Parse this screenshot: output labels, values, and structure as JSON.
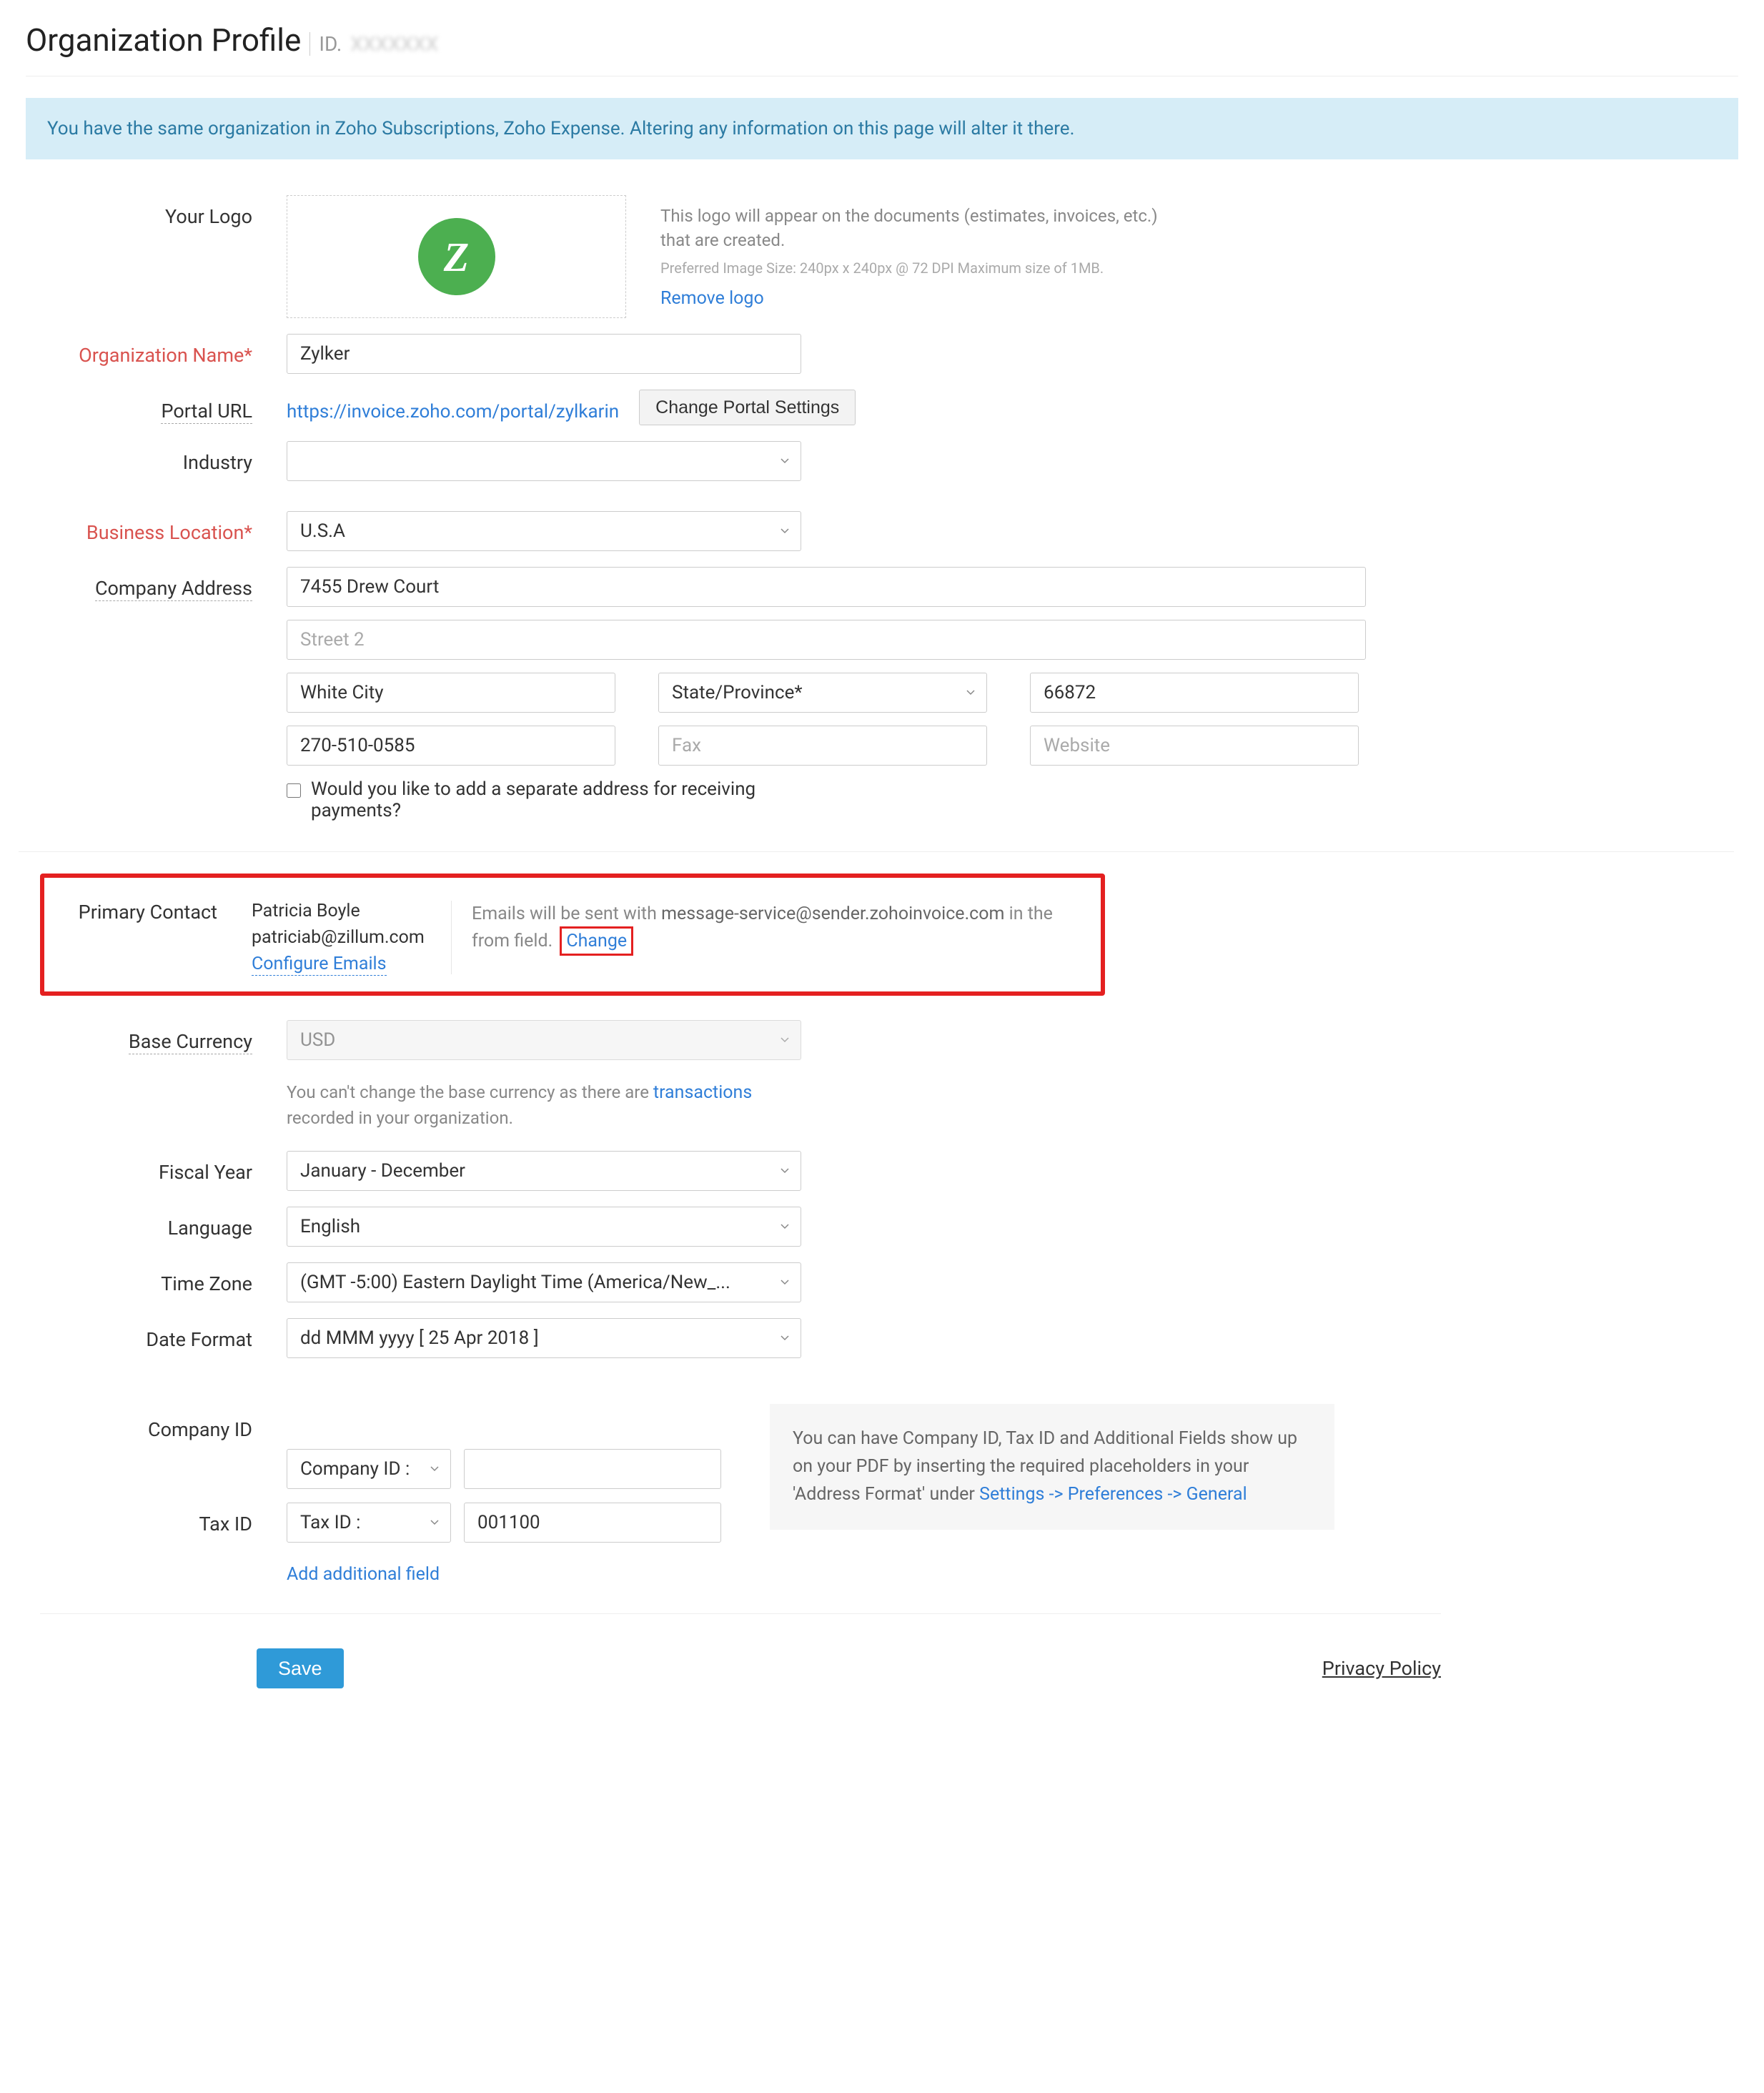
{
  "header": {
    "title": "Organization Profile",
    "id_label": "ID.",
    "id_value": "XXXXXXX"
  },
  "notice": "You have the same organization in Zoho Subscriptions, Zoho Expense. Altering any information on this page will alter it there.",
  "labels": {
    "logo": "Your Logo",
    "org_name": "Organization Name*",
    "portal_url": "Portal URL",
    "industry": "Industry",
    "business_location": "Business Location*",
    "company_address": "Company Address",
    "primary_contact": "Primary Contact",
    "base_currency": "Base Currency",
    "fiscal_year": "Fiscal Year",
    "language": "Language",
    "time_zone": "Time Zone",
    "date_format": "Date Format",
    "company_id": "Company ID",
    "tax_id": "Tax ID"
  },
  "logo": {
    "letter": "Z",
    "desc": "This logo will appear on the documents (estimates, invoices, etc.) that are created.",
    "hint": "Preferred Image Size: 240px x 240px @ 72 DPI Maximum size of 1MB.",
    "remove": "Remove logo"
  },
  "org": {
    "name": "Zylker",
    "portal_url": "https://invoice.zoho.com/portal/zylkarin",
    "change_portal_btn": "Change Portal Settings",
    "industry": "",
    "business_location": "U.S.A",
    "street1": "7455 Drew Court",
    "street2_placeholder": "Street 2",
    "city": "White City",
    "state_placeholder": "State/Province*",
    "zip": "66872",
    "phone": "270-510-0585",
    "fax_placeholder": "Fax",
    "website_placeholder": "Website",
    "separate_address_q": "Would you like to add a separate address for receiving payments?"
  },
  "primary_contact": {
    "name": "Patricia Boyle",
    "email": "patriciab@zillum.com",
    "configure": "Configure Emails",
    "msg_prefix": "Emails will be sent with ",
    "msg_email": "message-service@sender.zohoinvoice.com",
    "msg_suffix": " in the from field.",
    "change": "Change"
  },
  "currency": {
    "value": "USD",
    "note_prefix": "You can't change the base currency as there are ",
    "note_link": "transactions",
    "note_suffix": " recorded in your organization."
  },
  "fiscal_year": "January - December",
  "language": "English",
  "time_zone": "(GMT -5:00) Eastern Daylight Time (America/New_...",
  "date_format": "dd MMM yyyy [ 25 Apr 2018 ]",
  "ids": {
    "company_id_label": "Company ID :",
    "company_id_value": "",
    "tax_id_label": "Tax ID :",
    "tax_id_value": "001100",
    "add_field": "Add additional field",
    "info_prefix": "You can have Company ID, Tax ID and Additional Fields show up on your PDF by inserting the required placeholders in your 'Address Format' under ",
    "info_link": "Settings -> Preferences -> General"
  },
  "footer": {
    "save": "Save",
    "privacy": "Privacy Policy"
  }
}
